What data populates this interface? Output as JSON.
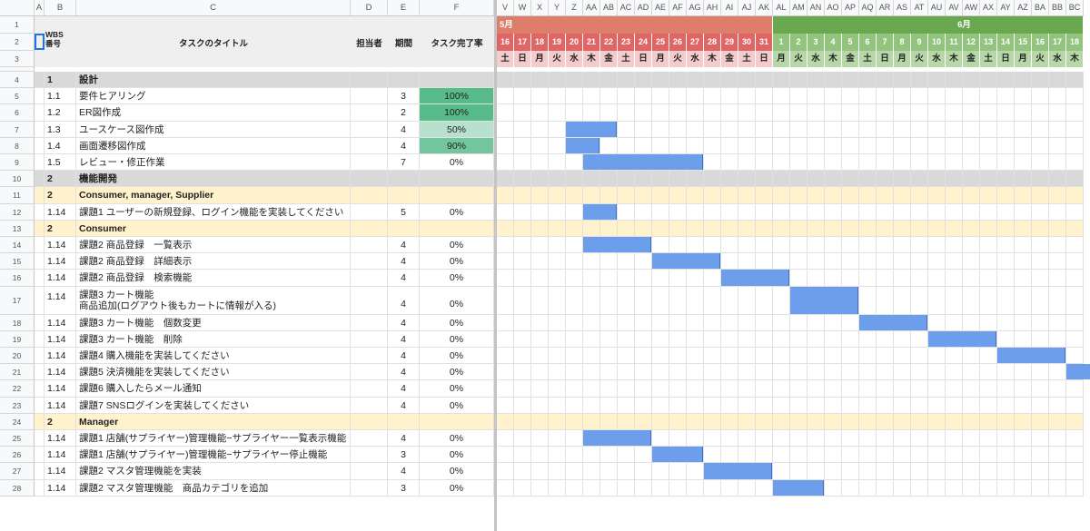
{
  "spreadsheet": {
    "col_letters": [
      "A",
      "B",
      "C",
      "D",
      "E",
      "F"
    ],
    "gantt_col_letters": [
      "V",
      "W",
      "X",
      "Y",
      "Z",
      "AA",
      "AB",
      "AC",
      "AD",
      "AE",
      "AF",
      "AG",
      "AH",
      "AI",
      "AJ",
      "AK",
      "AL",
      "AM",
      "AN",
      "AO",
      "AP",
      "AQ",
      "AR",
      "AS",
      "AT",
      "AU",
      "AV",
      "AW",
      "AX",
      "AY",
      "AZ",
      "BA",
      "BB",
      "BC"
    ],
    "headers": {
      "wbs": "WBS\n番号",
      "title": "タスクのタイトル",
      "assignee": "担当者",
      "duration": "期間",
      "completion": "タスク完了率"
    },
    "months": [
      {
        "label": "5月",
        "span": 16,
        "color": "#dd7e6b"
      },
      {
        "label": "6月",
        "span": 18,
        "color": "#6aa84f"
      }
    ],
    "days": [
      "16",
      "17",
      "18",
      "19",
      "20",
      "21",
      "22",
      "23",
      "24",
      "25",
      "26",
      "27",
      "28",
      "29",
      "30",
      "31",
      "1",
      "2",
      "3",
      "4",
      "5",
      "6",
      "7",
      "8",
      "9",
      "10",
      "11",
      "12",
      "13",
      "14",
      "15",
      "16",
      "17",
      "18"
    ],
    "weekdays": [
      "土",
      "日",
      "月",
      "火",
      "水",
      "木",
      "金",
      "土",
      "日",
      "月",
      "火",
      "水",
      "木",
      "金",
      "土",
      "日",
      "月",
      "火",
      "水",
      "木",
      "金",
      "土",
      "日",
      "月",
      "火",
      "水",
      "木",
      "金",
      "土",
      "日",
      "月",
      "火",
      "水",
      "木"
    ],
    "colors": {
      "may_day_bg": "#f4cccc",
      "june_day_bg": "#b6d7a8",
      "bar": "#6d9eeb",
      "section_gray": "#d9d9d9",
      "subsection_yellow": "#fff2cc",
      "pct_100": "#57bb8a",
      "pct_90": "#73c59d",
      "pct_50": "#b7e1cd"
    },
    "rows": [
      {
        "n": "4",
        "type": "section",
        "wbs": "1",
        "title": "設計",
        "duration": "",
        "pct": "",
        "bar": null
      },
      {
        "n": "5",
        "type": "task",
        "wbs": "1.1",
        "title": "要件ヒアリング",
        "duration": "3",
        "pct": "100%",
        "pct_bg": "#57bb8a",
        "bar": null
      },
      {
        "n": "6",
        "type": "task",
        "wbs": "1.2",
        "title": "ER図作成",
        "duration": "2",
        "pct": "100%",
        "pct_bg": "#57bb8a",
        "bar": null
      },
      {
        "n": "7",
        "type": "task",
        "wbs": "1.3",
        "title": "ユースケース図作成",
        "duration": "4",
        "pct": "50%",
        "pct_bg": "#b7e1cd",
        "bar": [
          4,
          3
        ]
      },
      {
        "n": "8",
        "type": "task",
        "wbs": "1.4",
        "title": "画面遷移図作成",
        "duration": "4",
        "pct": "90%",
        "pct_bg": "#73c59d",
        "bar": [
          4,
          2
        ]
      },
      {
        "n": "9",
        "type": "task",
        "wbs": "1.5",
        "title": "レビュー・修正作業",
        "duration": "7",
        "pct": "0%",
        "bar": [
          5,
          7
        ]
      },
      {
        "n": "10",
        "type": "section",
        "wbs": "2",
        "title": "機能開発",
        "duration": "",
        "pct": "",
        "bar": null
      },
      {
        "n": "11",
        "type": "sub",
        "wbs": "2",
        "title": "Consumer, manager, Supplier",
        "duration": "",
        "pct": "",
        "bar": null
      },
      {
        "n": "12",
        "type": "task",
        "wbs": "1.14",
        "title": "課題1 ユーザーの新規登録、ログイン機能を実装してください",
        "duration": "5",
        "pct": "0%",
        "bar": [
          5,
          2
        ]
      },
      {
        "n": "13",
        "type": "sub",
        "wbs": "2",
        "title": "Consumer",
        "duration": "",
        "pct": "",
        "bar": null
      },
      {
        "n": "14",
        "type": "task",
        "wbs": "1.14",
        "title": "課題2 商品登録　一覧表示",
        "duration": "4",
        "pct": "0%",
        "bar": [
          5,
          4
        ]
      },
      {
        "n": "15",
        "type": "task",
        "wbs": "1.14",
        "title": "課題2 商品登録　詳細表示",
        "duration": "4",
        "pct": "0%",
        "bar": [
          9,
          4
        ]
      },
      {
        "n": "16",
        "type": "task",
        "wbs": "1.14",
        "title": "課題2 商品登録　検索機能",
        "duration": "4",
        "pct": "0%",
        "bar": [
          13,
          4
        ]
      },
      {
        "n": "17",
        "type": "task2",
        "wbs": "1.14",
        "title": "課題3 カート機能",
        "title2": "商品追加(ログアウト後もカートに情報が入る)",
        "duration": "4",
        "pct": "0%",
        "bar": [
          17,
          4
        ]
      },
      {
        "n": "18",
        "type": "task",
        "wbs": "1.14",
        "title": "課題3 カート機能　個数変更",
        "duration": "4",
        "pct": "0%",
        "bar": [
          21,
          4
        ]
      },
      {
        "n": "19",
        "type": "task",
        "wbs": "1.14",
        "title": "課題3 カート機能　削除",
        "duration": "4",
        "pct": "0%",
        "bar": [
          25,
          4
        ]
      },
      {
        "n": "20",
        "type": "task",
        "wbs": "1.14",
        "title": "課題4 購入機能を実装してください",
        "duration": "4",
        "pct": "0%",
        "bar": [
          29,
          4
        ]
      },
      {
        "n": "21",
        "type": "task",
        "wbs": "1.14",
        "title": "課題5 決済機能を実装してください",
        "duration": "4",
        "pct": "0%",
        "bar": [
          33,
          2
        ]
      },
      {
        "n": "22",
        "type": "task",
        "wbs": "1.14",
        "title": "課題6 購入したらメール通知",
        "duration": "4",
        "pct": "0%",
        "bar": null
      },
      {
        "n": "23",
        "type": "task",
        "wbs": "1.14",
        "title": "課題7 SNSログインを実装してください",
        "duration": "4",
        "pct": "0%",
        "bar": null
      },
      {
        "n": "24",
        "type": "sub",
        "wbs": "2",
        "title": "Manager",
        "duration": "",
        "pct": "",
        "bar": null
      },
      {
        "n": "25",
        "type": "task",
        "wbs": "1.14",
        "title": "課題1 店舗(サプライヤー)管理機能−サプライヤー一覧表示機能",
        "duration": "4",
        "pct": "0%",
        "bar": [
          5,
          4
        ]
      },
      {
        "n": "26",
        "type": "task",
        "wbs": "1.14",
        "title": "課題1 店舗(サプライヤー)管理機能−サプライヤー停止機能",
        "duration": "3",
        "pct": "0%",
        "bar": [
          9,
          3
        ]
      },
      {
        "n": "27",
        "type": "task",
        "wbs": "1.14",
        "title": "課題2 マスタ管理機能を実装",
        "duration": "4",
        "pct": "0%",
        "bar": [
          12,
          4
        ]
      },
      {
        "n": "28",
        "type": "task",
        "wbs": "1.14",
        "title": "課題2 マスタ管理機能　商品カテゴリを追加",
        "duration": "3",
        "pct": "0%",
        "bar": [
          16,
          3
        ]
      }
    ]
  }
}
